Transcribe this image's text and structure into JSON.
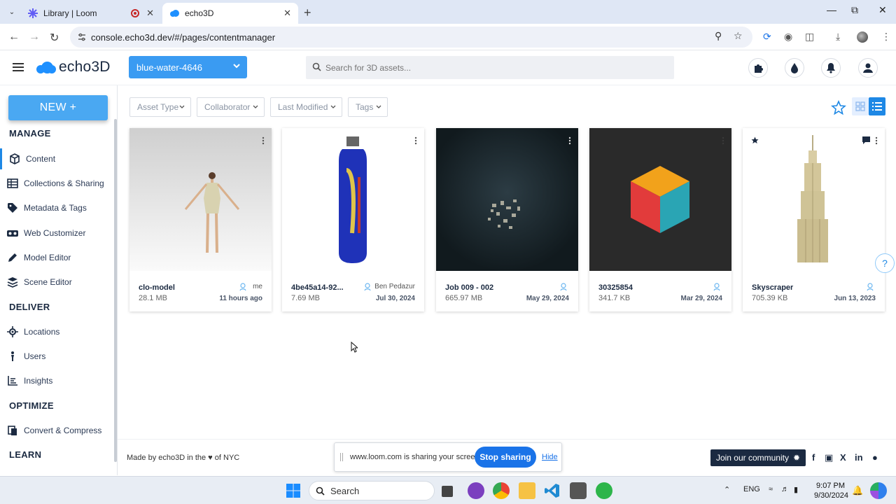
{
  "browser": {
    "tabs": [
      {
        "title": "Library | Loom",
        "active": false
      },
      {
        "title": "echo3D",
        "active": true
      }
    ],
    "url": "console.echo3d.dev/#/pages/contentmanager"
  },
  "header": {
    "logo_text": "echo3D",
    "project": "blue-water-4646",
    "search_placeholder": "Search for 3D assets..."
  },
  "sidebar": {
    "new_button": "NEW +",
    "sections": {
      "manage": "MANAGE",
      "deliver": "DELIVER",
      "optimize": "OPTIMIZE",
      "learn": "LEARN"
    },
    "items": [
      {
        "label": "Content",
        "icon": "cube-icon",
        "active": true
      },
      {
        "label": "Collections & Sharing",
        "icon": "table-icon"
      },
      {
        "label": "Metadata & Tags",
        "icon": "tag-icon"
      },
      {
        "label": "Web Customizer",
        "icon": "vr-icon"
      },
      {
        "label": "Model Editor",
        "icon": "pencil-icon"
      },
      {
        "label": "Scene Editor",
        "icon": "layers-icon"
      },
      {
        "label": "Locations",
        "icon": "location-icon"
      },
      {
        "label": "Users",
        "icon": "person-icon"
      },
      {
        "label": "Insights",
        "icon": "chart-icon"
      },
      {
        "label": "Convert & Compress",
        "icon": "convert-icon"
      }
    ]
  },
  "filters": [
    "Asset Type",
    "Collaborator",
    "Last Modified",
    "Tags"
  ],
  "cards": [
    {
      "name": "clo-model",
      "size": "28.1 MB",
      "owner": "me",
      "date": "11 hours ago"
    },
    {
      "name": "4be45a14-92...",
      "size": "7.69 MB",
      "owner": "Ben Pedazur",
      "date": "Jul 30, 2024"
    },
    {
      "name": "Job 009 - 002",
      "size": "665.97 MB",
      "owner": "",
      "date": "May 29, 2024"
    },
    {
      "name": "30325854",
      "size": "341.7 KB",
      "owner": "",
      "date": "Mar 29, 2024"
    },
    {
      "name": "Skyscraper",
      "size": "705.39 KB",
      "owner": "",
      "date": "Jun 13, 2023"
    }
  ],
  "footer": {
    "made_by": "Made by echo3D in the ♥ of NYC",
    "join": "Join our community",
    "social": [
      "f",
      "▣",
      "X",
      "in",
      "●"
    ]
  },
  "share_bar": {
    "text": "www.loom.com is sharing your screen.",
    "stop": "Stop sharing",
    "hide": "Hide"
  },
  "taskbar": {
    "search": "Search",
    "lang": "ENG",
    "time": "9:07 PM",
    "date": "9/30/2024"
  },
  "colors": {
    "accent": "#3a9bf2",
    "dark": "#1b2a41",
    "active_nav": "#1e88e5"
  }
}
